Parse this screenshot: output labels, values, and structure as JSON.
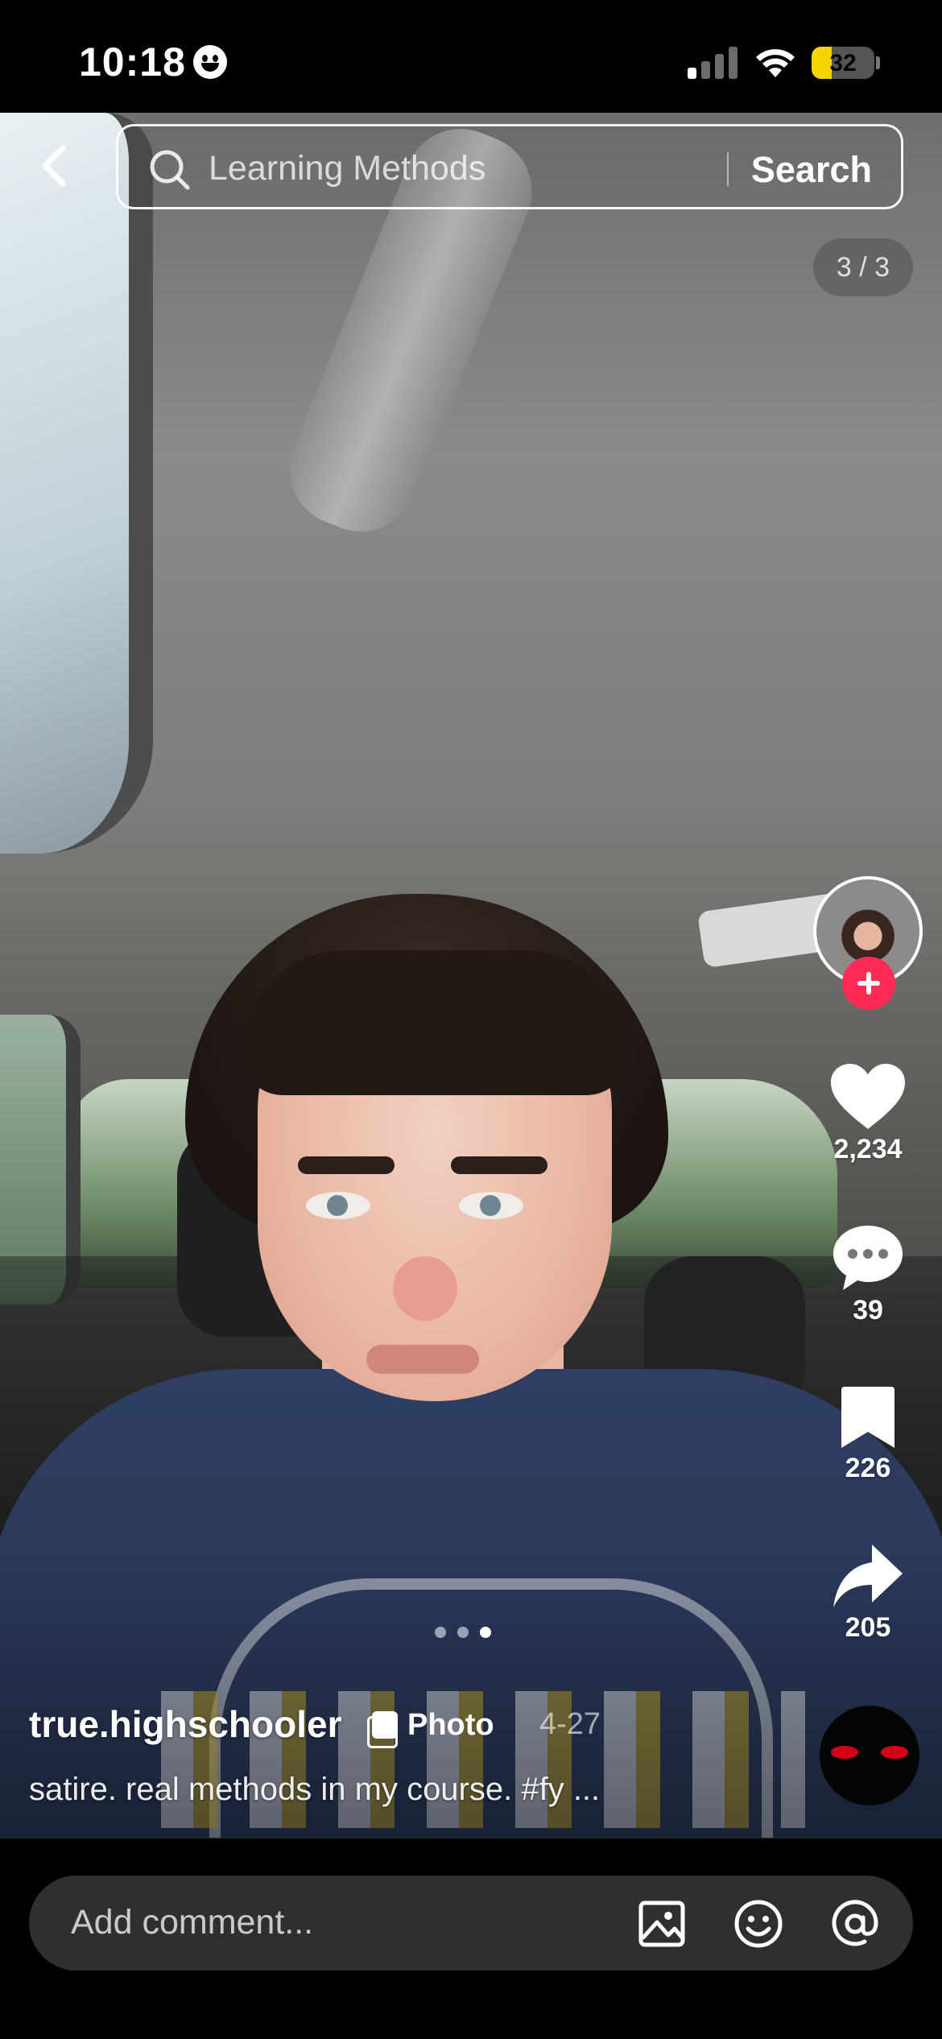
{
  "status_bar": {
    "time": "10:18",
    "battery_percent": "32",
    "battery_level": 0.32,
    "battery_color": "#f5d400",
    "signal_bars_active": 1,
    "icons": [
      "smiley-icon",
      "cellular-signal-icon",
      "wifi-icon",
      "battery-icon"
    ]
  },
  "header": {
    "back_icon": "chevron-left-icon",
    "search_placeholder": "Learning Methods",
    "search_button_label": "Search",
    "search_icon": "search-icon"
  },
  "carousel": {
    "page_indicator": "3 / 3",
    "current_page": 3,
    "total_pages": 3
  },
  "right_rail": {
    "likes": "2,234",
    "comments": "39",
    "saves": "226",
    "shares": "205",
    "follow_color": "#fe2c55",
    "icons": [
      "heart-icon",
      "comment-bubble-icon",
      "bookmark-icon",
      "share-arrow-icon",
      "follow-plus-icon"
    ]
  },
  "post": {
    "username": "true.highschooler",
    "type_badge": "Photo",
    "date": "4-27",
    "caption": "satire. real methods in my course. #fy ..."
  },
  "comment_bar": {
    "placeholder": "Add comment...",
    "icons": [
      "image-icon",
      "emoji-icon",
      "mention-icon"
    ]
  }
}
